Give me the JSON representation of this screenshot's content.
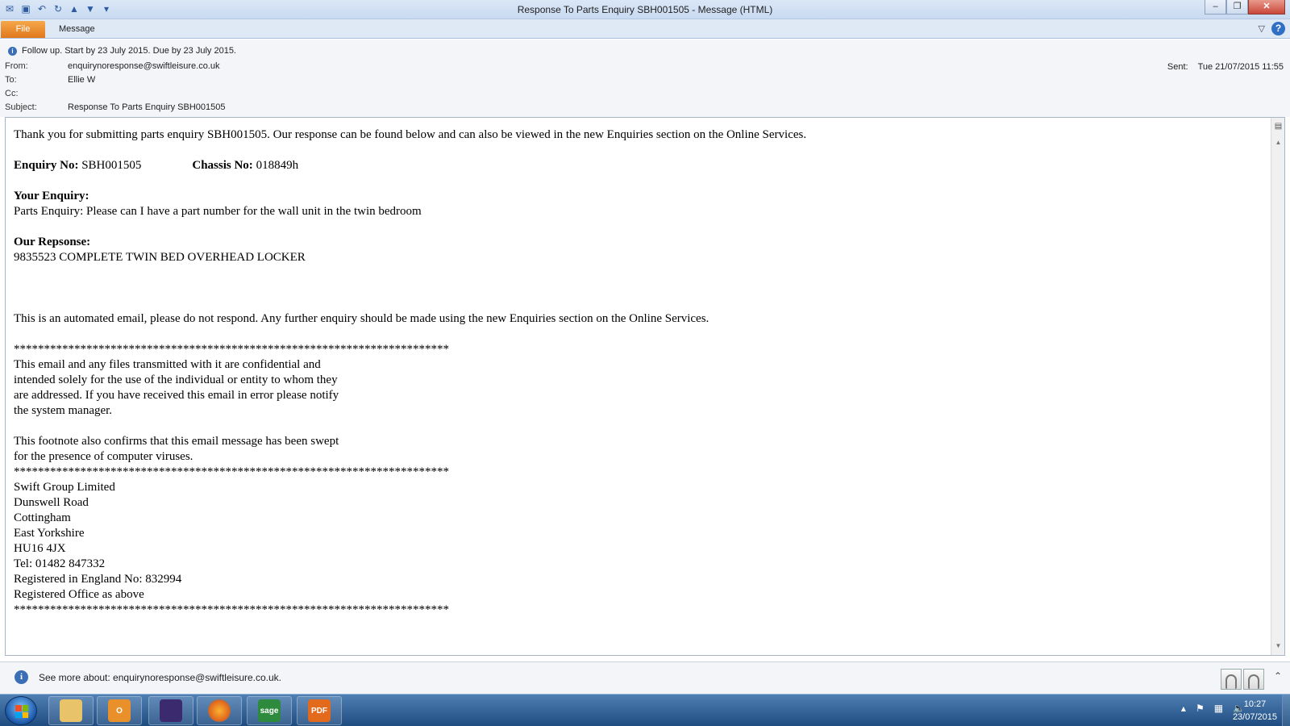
{
  "window": {
    "title": "Response To Parts Enquiry SBH001505  -  Message (HTML)",
    "minimize": "‒",
    "maximize": "❐",
    "close": "✕"
  },
  "ribbon": {
    "file_tab": "File",
    "message_tab": "Message",
    "help": "?"
  },
  "header": {
    "followup": "Follow up.  Start by 23 July 2015.  Due by 23 July 2015.",
    "from_label": "From:",
    "from_value": "enquirynoresponse@swiftleisure.co.uk",
    "to_label": "To:",
    "to_value": "Ellie W",
    "cc_label": "Cc:",
    "cc_value": "",
    "subject_label": "Subject:",
    "subject_value": "Response To Parts Enquiry SBH001505",
    "sent_label": "Sent:",
    "sent_value": "Tue 21/07/2015 11:55"
  },
  "message": {
    "intro": "Thank you for submitting parts enquiry SBH001505. Our response can be found below and can also be viewed in the new Enquiries section on the Online Services.",
    "enquiry_no_label": "Enquiry No:",
    "enquiry_no_value": " SBH001505",
    "chassis_no_label": "Chassis No:",
    "chassis_no_value": " 018849h",
    "your_enquiry_heading": "Your Enquiry:",
    "your_enquiry_text": "Parts Enquiry: Please can I have a part number for the wall unit in the twin bedroom",
    "our_response_heading": "Our Repsonse:",
    "our_response_text": "9835523 COMPLETE TWIN BED OVERHEAD LOCKER",
    "automated_notice": "This is an automated email, please do not respond. Any further enquiry should be made using the new Enquiries section on the Online Services.",
    "stars": "************************************************************************",
    "confidential_lines": [
      "This email and any files transmitted with it are confidential and",
      "intended solely for the use of the individual or entity to whom they",
      "are addressed. If you have received this email in error please notify",
      "the system manager."
    ],
    "virus_lines": [
      "This footnote also confirms that this email message has been swept",
      "for the presence of computer viruses."
    ],
    "address_lines": [
      "Swift Group Limited",
      "Dunswell Road",
      "Cottingham",
      "East Yorkshire",
      "HU16 4JX",
      "Tel: 01482 847332",
      "Registered in England No: 832994",
      "Registered Office as above"
    ]
  },
  "people": {
    "see_more": "See more about: enquirynoresponse@swiftleisure.co.uk."
  },
  "taskbar": {
    "apps": [
      {
        "name": "explorer",
        "label": "",
        "color": "#e8c36a"
      },
      {
        "name": "outlook",
        "label": "O",
        "color": "#e9902a"
      },
      {
        "name": "calculator",
        "label": "",
        "color": "#3b2a6e"
      },
      {
        "name": "firefox",
        "label": "",
        "color": "#e36a1c"
      },
      {
        "name": "sage",
        "label": "sage",
        "color": "#2e8b3e"
      },
      {
        "name": "pdf",
        "label": "PDF",
        "color": "#e36a1c"
      }
    ],
    "time": "10:27",
    "date": "23/07/2015"
  }
}
